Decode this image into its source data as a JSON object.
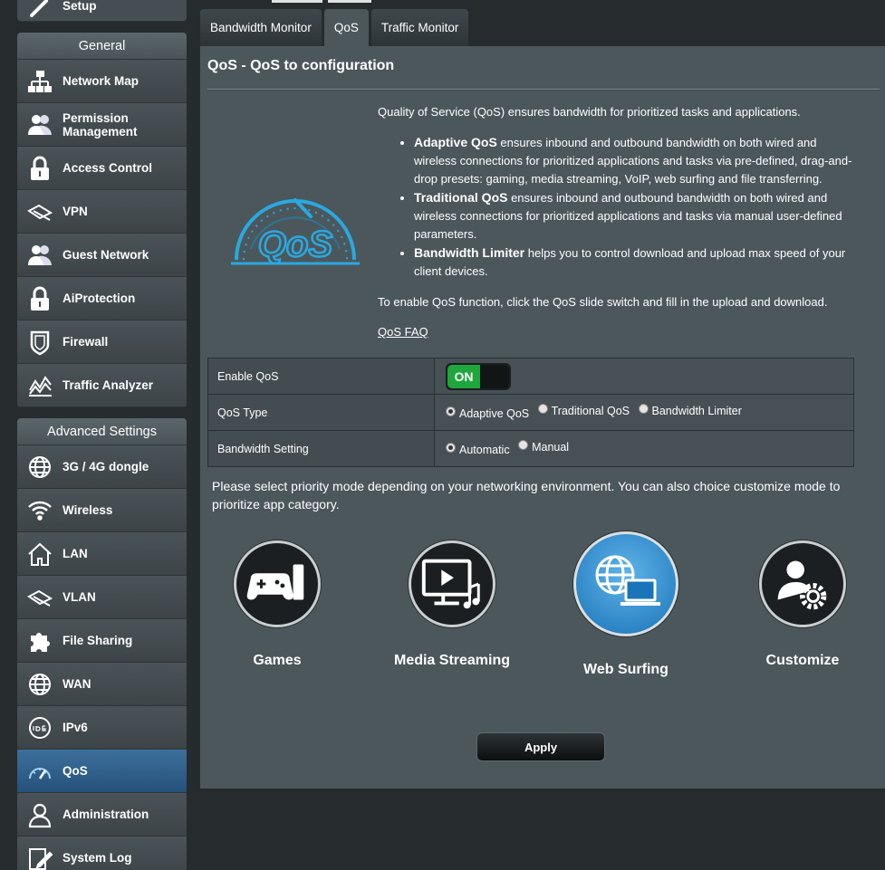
{
  "sidebar": {
    "setup_label": "Setup",
    "general_header": "General",
    "general_items": [
      {
        "label": "Network Map",
        "icon": "network-map-icon"
      },
      {
        "label": "Permission Management",
        "icon": "users-icon"
      },
      {
        "label": "Access Control",
        "icon": "lock-icon"
      },
      {
        "label": "VPN",
        "icon": "vpn-icon"
      },
      {
        "label": "Guest Network",
        "icon": "users-icon"
      },
      {
        "label": "AiProtection",
        "icon": "lock-icon"
      },
      {
        "label": "Firewall",
        "icon": "shield-icon"
      },
      {
        "label": "Traffic Analyzer",
        "icon": "chart-icon"
      }
    ],
    "advanced_header": "Advanced Settings",
    "advanced_items": [
      {
        "label": "3G / 4G dongle",
        "icon": "globe-icon"
      },
      {
        "label": "Wireless",
        "icon": "wifi-icon"
      },
      {
        "label": "LAN",
        "icon": "house-icon"
      },
      {
        "label": "VLAN",
        "icon": "vpn-icon"
      },
      {
        "label": "File Sharing",
        "icon": "puzzle-icon"
      },
      {
        "label": "WAN",
        "icon": "globe-icon"
      },
      {
        "label": "IPv6",
        "icon": "ipv6-icon"
      },
      {
        "label": "QoS",
        "icon": "gauge-icon"
      },
      {
        "label": "Administration",
        "icon": "admin-icon"
      },
      {
        "label": "System Log",
        "icon": "log-icon"
      }
    ]
  },
  "tabs": [
    {
      "label": "Bandwidth Monitor"
    },
    {
      "label": "QoS"
    },
    {
      "label": "Traffic Monitor"
    }
  ],
  "page": {
    "title": "QoS - QoS to configuration",
    "logo_text": "QoS",
    "intro": "Quality of Service (QoS) ensures bandwidth for prioritized tasks and applications.",
    "bullets": [
      {
        "bold": "Adaptive QoS",
        "text": " ensures inbound and outbound bandwidth on both wired and wireless connections for prioritized applications and tasks via pre-defined, drag-and-drop presets: gaming, media streaming, VoIP, web surfing and file transferring."
      },
      {
        "bold": "Traditional QoS",
        "text": " ensures inbound and outbound bandwidth on both wired and wireless connections for prioritized applications and tasks via manual user-defined parameters."
      },
      {
        "bold": "Bandwidth Limiter",
        "text": " helps you to control download and upload max speed of your client devices."
      }
    ],
    "enable_note": "To enable QoS function, click the QoS slide switch and fill in the upload and download.",
    "faq_link": "QoS FAQ"
  },
  "settings": {
    "enable_label": "Enable QoS",
    "enable_state": "ON",
    "type_label": "QoS Type",
    "type_options": [
      "Adaptive QoS",
      "Traditional QoS",
      "Bandwidth Limiter"
    ],
    "type_selected": "Adaptive QoS",
    "bandwidth_label": "Bandwidth Setting",
    "bandwidth_options": [
      "Automatic",
      "Manual"
    ],
    "bandwidth_selected": "Automatic"
  },
  "priority_text": "Please select priority mode depending on your networking environment. You can also choice customize mode to prioritize app category.",
  "modes": [
    {
      "label": "Games",
      "icon": "gamepad-icon"
    },
    {
      "label": "Media Streaming",
      "icon": "media-icon"
    },
    {
      "label": "Web Surfing",
      "icon": "web-surfing-icon"
    },
    {
      "label": "Customize",
      "icon": "customize-icon"
    }
  ],
  "selected_mode": "Web Surfing",
  "apply_label": "Apply",
  "colors": {
    "accent": "#1a73b8",
    "toggle_on": "#1fa63c",
    "logo": "#29a9e0"
  }
}
